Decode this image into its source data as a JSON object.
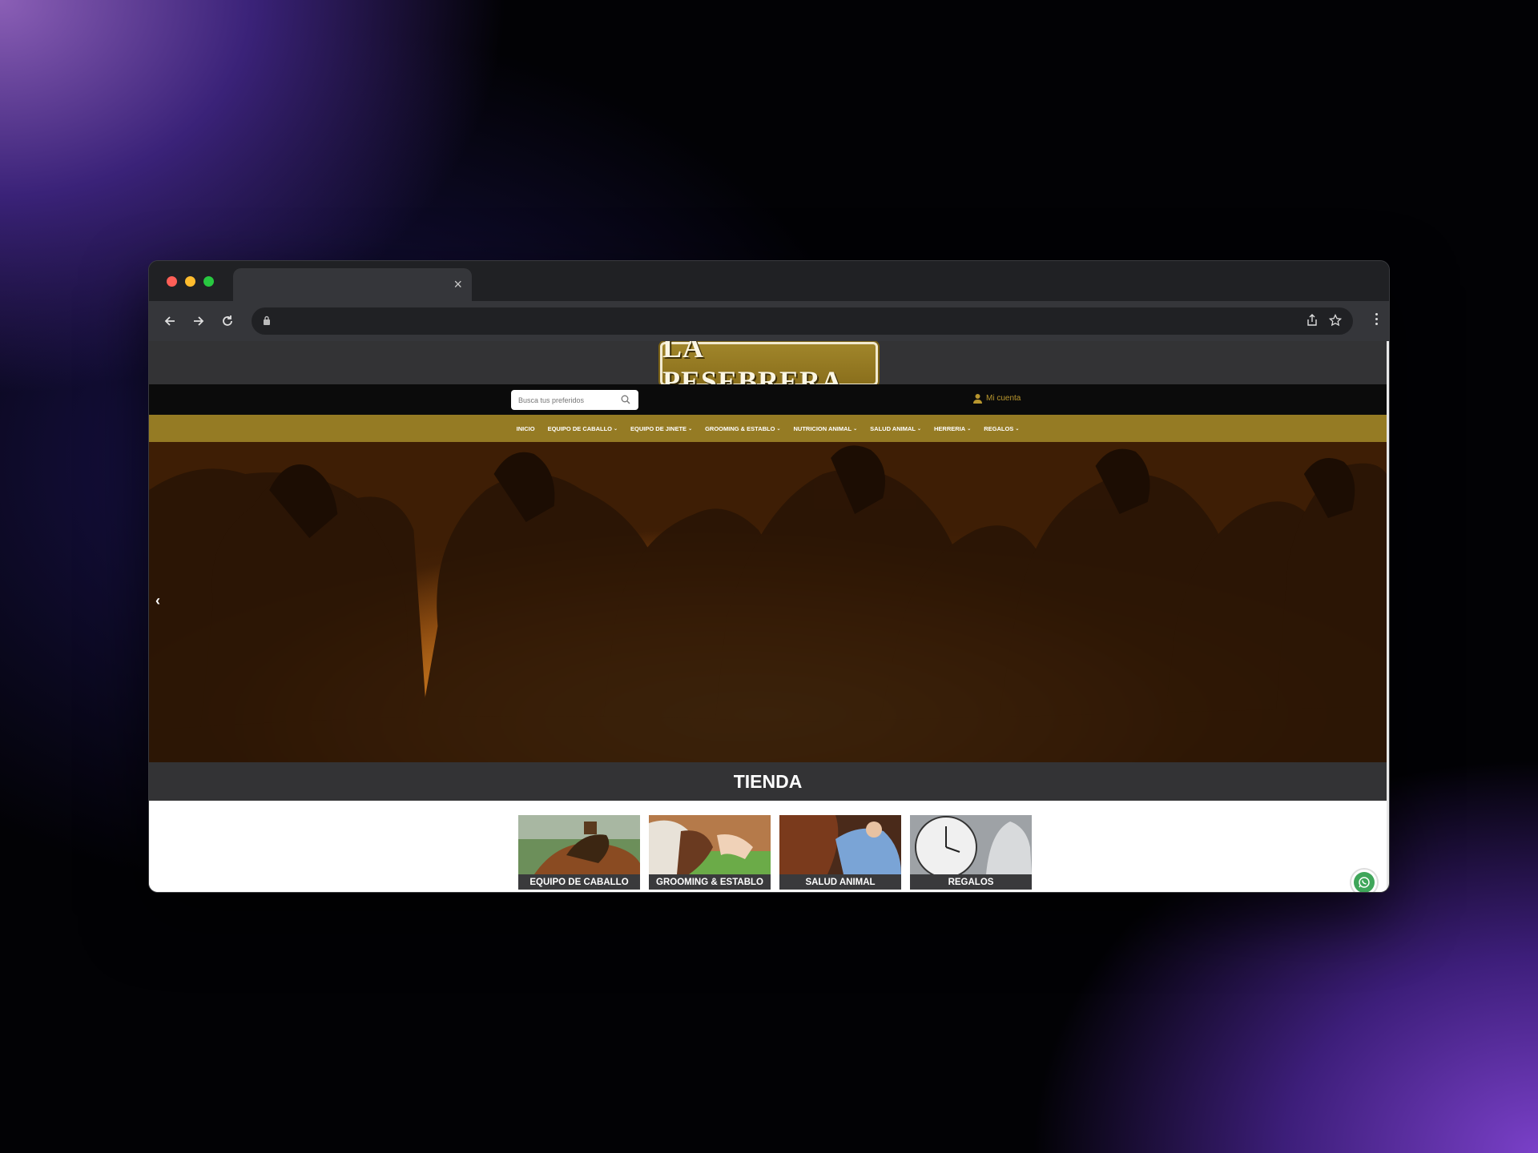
{
  "browser": {
    "tab_title": "",
    "tab_close": "×",
    "url": ""
  },
  "site": {
    "logo_text": "LA PESEBRERA",
    "search": {
      "placeholder": "Busca tus preferidos"
    },
    "account_label": "Mi cuenta",
    "menu": [
      {
        "label": "INICIO",
        "has_caret": false
      },
      {
        "label": "EQUIPO DE CABALLO",
        "has_caret": true
      },
      {
        "label": "EQUIPO DE JINETE",
        "has_caret": true
      },
      {
        "label": "GROOMING & ESTABLO",
        "has_caret": true
      },
      {
        "label": "NUTRICION ANIMAL",
        "has_caret": true
      },
      {
        "label": "SALUD ANIMAL",
        "has_caret": true
      },
      {
        "label": "HERRERIA",
        "has_caret": true
      },
      {
        "label": "REGALOS",
        "has_caret": true
      }
    ],
    "hero_prev": "‹",
    "section_title": "TIENDA",
    "categories": [
      {
        "label": "EQUIPO DE CABALLO"
      },
      {
        "label": "GROOMING & ESTABLO"
      },
      {
        "label": "SALUD ANIMAL"
      },
      {
        "label": "REGALOS"
      }
    ]
  },
  "colors": {
    "brand_gold": "#957b24",
    "dark_bar": "#333335",
    "whatsapp_green": "#3fa65a"
  }
}
